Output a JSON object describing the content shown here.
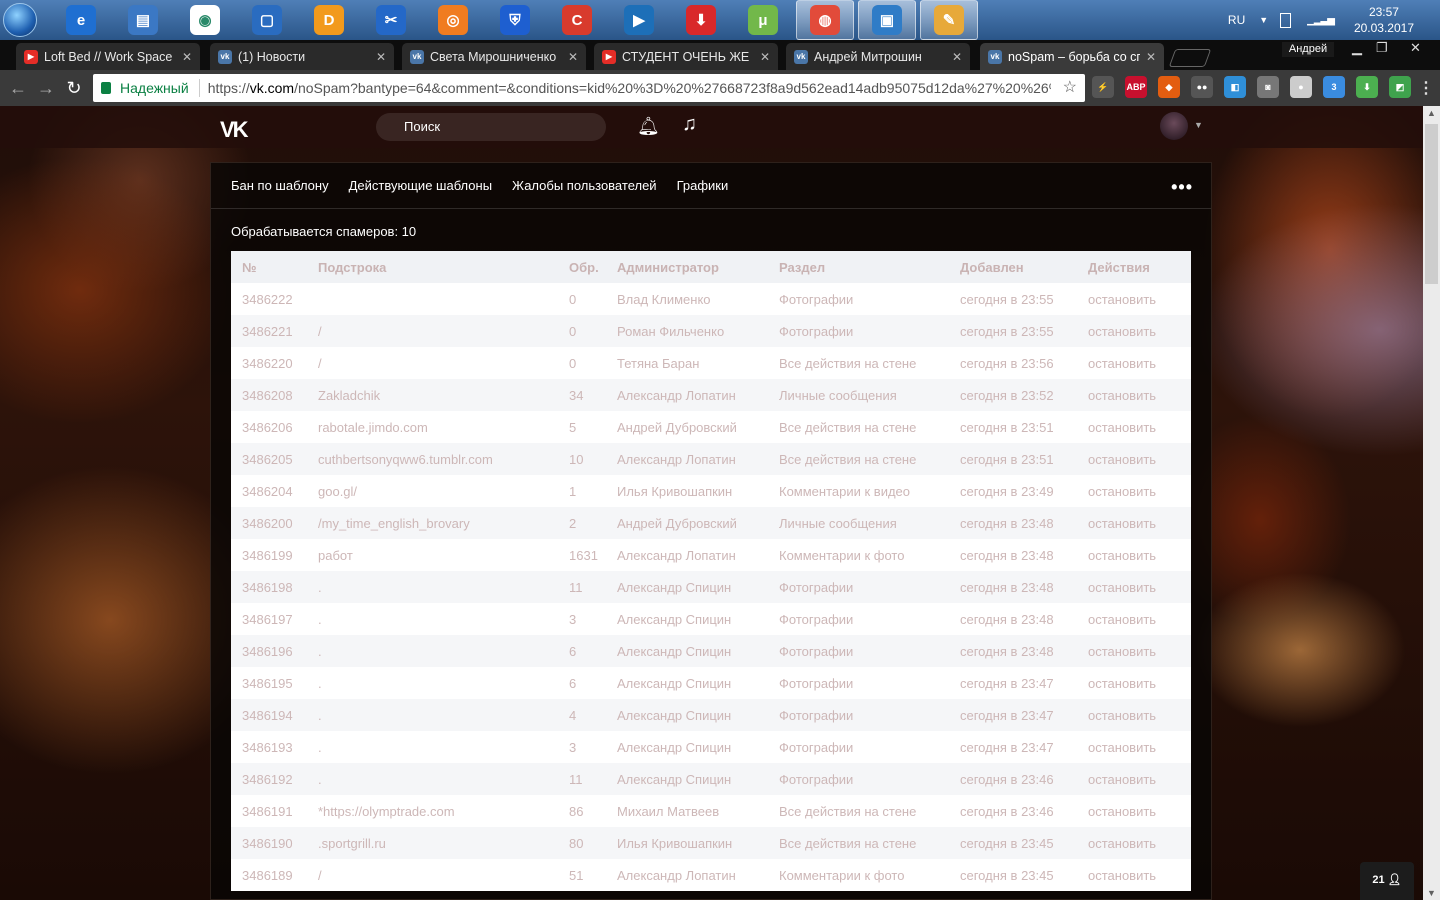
{
  "taskbar": {
    "apps": [
      {
        "icon": "ie-icon",
        "color": "#1f6fd1",
        "glyph": "e"
      },
      {
        "icon": "documents-icon",
        "color": "#3b78c4",
        "glyph": "▤"
      },
      {
        "icon": "maps-pin-icon",
        "color": "#ffffff",
        "glyph": "◉"
      },
      {
        "icon": "window-app-icon",
        "color": "#2a6cc0",
        "glyph": "▢"
      },
      {
        "icon": "dlink-icon",
        "color": "#f29a1d",
        "glyph": "D"
      },
      {
        "icon": "tools-icon",
        "color": "#2468c8",
        "glyph": "✂"
      },
      {
        "icon": "avast-icon",
        "color": "#f07c20",
        "glyph": "◎"
      },
      {
        "icon": "shield-icon",
        "color": "#1e5fd0",
        "glyph": "⛨"
      },
      {
        "icon": "ccleaner-icon",
        "color": "#d83b2d",
        "glyph": "C"
      },
      {
        "icon": "media-player-icon",
        "color": "#1d6fb8",
        "glyph": "▶"
      },
      {
        "icon": "download-icon",
        "color": "#d9282a",
        "glyph": "⬇"
      },
      {
        "icon": "utorrent-icon",
        "color": "#72b84a",
        "glyph": "μ"
      },
      {
        "icon": "chrome-icon",
        "color": "#e24b3a",
        "glyph": "◍"
      },
      {
        "icon": "monitor-icon",
        "color": "#2f7cc7",
        "glyph": "▣"
      },
      {
        "icon": "paint-icon",
        "color": "#e7a93a",
        "glyph": "✎"
      }
    ],
    "lang": "RU",
    "time": "23:57",
    "date": "20.03.2017"
  },
  "tabs": [
    {
      "title": "Loft Bed // Work Space",
      "fav": "yt"
    },
    {
      "title": "(1) Новости",
      "fav": "vk"
    },
    {
      "title": "Света Мирошниченко",
      "fav": "vk"
    },
    {
      "title": "СТУДЕНТ ОЧЕНЬ ЖЕ",
      "fav": "yt"
    },
    {
      "title": "Андрей Митрошин",
      "fav": "vk"
    },
    {
      "title": "noSpam – борьба со сп",
      "fav": "vk"
    }
  ],
  "window": {
    "user": "Андрей"
  },
  "address": {
    "secure_label": "Надежный",
    "prefix": "https://",
    "host": "vk.com",
    "rest": "/noSpam?bantype=64&comment=&conditions=kid%20%3D%20%27668723f8a9d562ead14adb95075d12da%27%20%26%"
  },
  "extensions": [
    {
      "name": "bolt-ext-icon",
      "color": "#555",
      "glyph": "⚡"
    },
    {
      "name": "adblock-ext-icon",
      "color": "#c8102e",
      "glyph": "ABP"
    },
    {
      "name": "fox-ext-icon",
      "color": "#e35d10",
      "glyph": "◆"
    },
    {
      "name": "people-ext-icon",
      "color": "#555",
      "glyph": "●●"
    },
    {
      "name": "square-ext-icon",
      "color": "#2f8fd8",
      "glyph": "◧"
    },
    {
      "name": "camera-ext-icon",
      "color": "#777",
      "glyph": "◙"
    },
    {
      "name": "circle-ext-icon",
      "color": "#ccc",
      "glyph": "●"
    },
    {
      "name": "cube-ext-icon",
      "color": "#3a8ce0",
      "glyph": "3"
    },
    {
      "name": "arrow-ext-icon",
      "color": "#4caf50",
      "glyph": "⬇"
    },
    {
      "name": "green-ext-icon",
      "color": "#3fa34d",
      "glyph": "◩"
    }
  ],
  "vk": {
    "logo": "VK",
    "search_placeholder": "Поиск"
  },
  "nav_tabs": [
    "Бан по шаблону",
    "Действующие шаблоны",
    "Жалобы пользователей",
    "Графики"
  ],
  "spammers_count": "Обрабатывается спамеров: 10",
  "table": {
    "headers": [
      "№",
      "Подстрока",
      "Обр.",
      "Администратор",
      "Раздел",
      "Добавлен",
      "Действия"
    ],
    "rows": [
      [
        "3486222",
        "",
        "0",
        "Влад Клименко",
        "Фотографии",
        "сегодня в 23:55",
        "остановить"
      ],
      [
        "3486221",
        "/",
        "0",
        "Роман Фильченко",
        "Фотографии",
        "сегодня в 23:55",
        "остановить"
      ],
      [
        "3486220",
        "/",
        "0",
        "Тетяна Баран",
        "Все действия на стене",
        "сегодня в 23:56",
        "остановить"
      ],
      [
        "3486208",
        "Zakladchik",
        "34",
        "Александр Лопатин",
        "Личные сообщения",
        "сегодня в 23:52",
        "остановить"
      ],
      [
        "3486206",
        "rabotale.jimdo.com",
        "5",
        "Андрей Дубровский",
        "Все действия на стене",
        "сегодня в 23:51",
        "остановить"
      ],
      [
        "3486205",
        "cuthbertsonyqww6.tumblr.com",
        "10",
        "Александр Лопатин",
        "Все действия на стене",
        "сегодня в 23:51",
        "остановить"
      ],
      [
        "3486204",
        "goo.gl/",
        "1",
        "Илья Кривошапкин",
        "Комментарии к видео",
        "сегодня в 23:49",
        "остановить"
      ],
      [
        "3486200",
        "/my_time_english_brovary",
        "2",
        "Андрей Дубровский",
        "Личные сообщения",
        "сегодня в 23:48",
        "остановить"
      ],
      [
        "3486199",
        "работ",
        "1631",
        "Александр Лопатин",
        "Комментарии к фото",
        "сегодня в 23:48",
        "остановить"
      ],
      [
        "3486198",
        ".",
        "11",
        "Александр Спицин",
        "Фотографии",
        "сегодня в 23:48",
        "остановить"
      ],
      [
        "3486197",
        ".",
        "3",
        "Александр Спицин",
        "Фотографии",
        "сегодня в 23:48",
        "остановить"
      ],
      [
        "3486196",
        ".",
        "6",
        "Александр Спицин",
        "Фотографии",
        "сегодня в 23:48",
        "остановить"
      ],
      [
        "3486195",
        ".",
        "6",
        "Александр Спицин",
        "Фотографии",
        "сегодня в 23:47",
        "остановить"
      ],
      [
        "3486194",
        ".",
        "4",
        "Александр Спицин",
        "Фотографии",
        "сегодня в 23:47",
        "остановить"
      ],
      [
        "3486193",
        ".",
        "3",
        "Александр Спицин",
        "Фотографии",
        "сегодня в 23:47",
        "остановить"
      ],
      [
        "3486192",
        ".",
        "11",
        "Александр Спицин",
        "Фотографии",
        "сегодня в 23:46",
        "остановить"
      ],
      [
        "3486191",
        "*https://olymptrade.com",
        "86",
        "Михаил Матвеев",
        "Все действия на стене",
        "сегодня в 23:46",
        "остановить"
      ],
      [
        "3486190",
        ".sportgrill.ru",
        "80",
        "Илья Кривошапкин",
        "Все действия на стене",
        "сегодня в 23:45",
        "остановить"
      ],
      [
        "3486189",
        "/",
        "51",
        "Александр Лопатин",
        "Комментарии к фото",
        "сегодня в 23:45",
        "остановить"
      ]
    ]
  },
  "online_badge": "21"
}
